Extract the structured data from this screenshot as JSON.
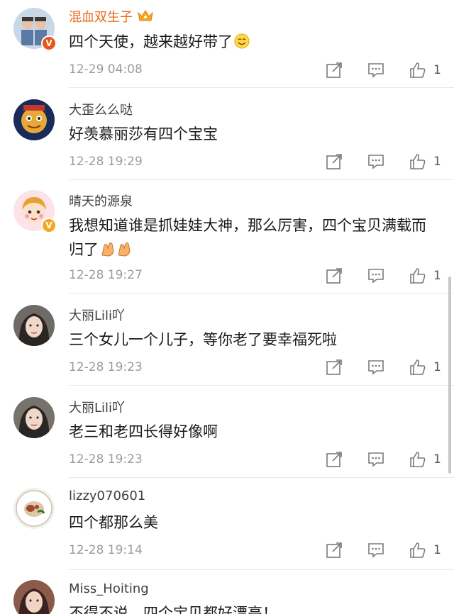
{
  "comments": [
    {
      "username": "混血双生子",
      "text": "四个天使，越来越好带了",
      "time": "12-29 04:08",
      "likes": "1",
      "avatar_icon": "twins-avatar",
      "verified": "red-v-badge",
      "vip_icon": "crown-icon"
    },
    {
      "username": "大歪么么哒",
      "text": "好羡慕丽莎有四个宝宝",
      "time": "12-28 19:29",
      "likes": "1",
      "avatar_icon": "cartoon-avatar"
    },
    {
      "username": "晴天的源泉",
      "text": "我想知道谁是抓娃娃大神，那么厉害，四个宝贝满载而归了",
      "time": "12-28 19:27",
      "likes": "1",
      "avatar_icon": "cartoon-girl-avatar",
      "verified": "yellow-v-badge"
    },
    {
      "username": "大丽Lili吖",
      "text": "三个女儿一个儿子，等你老了要幸福死啦",
      "time": "12-28 19:23",
      "likes": "1",
      "avatar_icon": "portrait-avatar"
    },
    {
      "username": "大丽Lili吖",
      "text": "老三和老四长得好像啊",
      "time": "12-28 19:23",
      "likes": "1",
      "avatar_icon": "portrait-avatar"
    },
    {
      "username": "lizzy070601",
      "text": "四个都那么美",
      "time": "12-28 19:14",
      "likes": "1",
      "avatar_icon": "food-plate-avatar"
    },
    {
      "username": "Miss_Hoiting",
      "text": "不得不说，四个宝贝都好漂亮！",
      "time": "",
      "likes": "",
      "avatar_icon": "portrait-avatar"
    }
  ],
  "colors": {
    "username": "#3f3f3f",
    "vip_username": "#e86b1c",
    "timestamp": "#9b9b9b",
    "icon": "#7a7a7a",
    "divider": "#e8e8e8"
  }
}
